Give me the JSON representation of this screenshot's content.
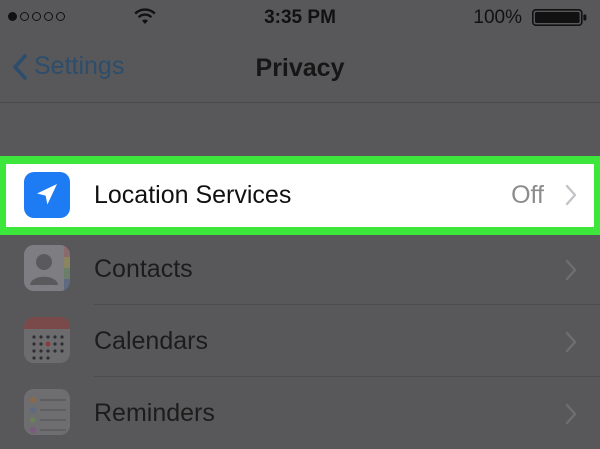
{
  "status_bar": {
    "signal_dots": 5,
    "signal_filled": 1,
    "time": "3:35 PM",
    "battery_percent": "100%",
    "icons": [
      "signal-dots-icon",
      "wifi-icon",
      "battery-icon"
    ]
  },
  "nav": {
    "back_label": "Settings",
    "title": "Privacy",
    "back_icon": "chevron-left-icon"
  },
  "rows": [
    {
      "label": "Location Services",
      "value": "Off",
      "icon": "location-arrow-icon",
      "highlighted": true
    },
    {
      "label": "Contacts",
      "value": "",
      "icon": "contacts-icon",
      "highlighted": false
    },
    {
      "label": "Calendars",
      "value": "",
      "icon": "calendar-icon",
      "highlighted": false
    },
    {
      "label": "Reminders",
      "value": "",
      "icon": "reminders-icon",
      "highlighted": false
    }
  ],
  "colors": {
    "dim_background": "#58585a",
    "highlight_border": "#3ce63a",
    "location_icon_bg": "#1d7bf3",
    "back_link": "#2c4d6c"
  }
}
